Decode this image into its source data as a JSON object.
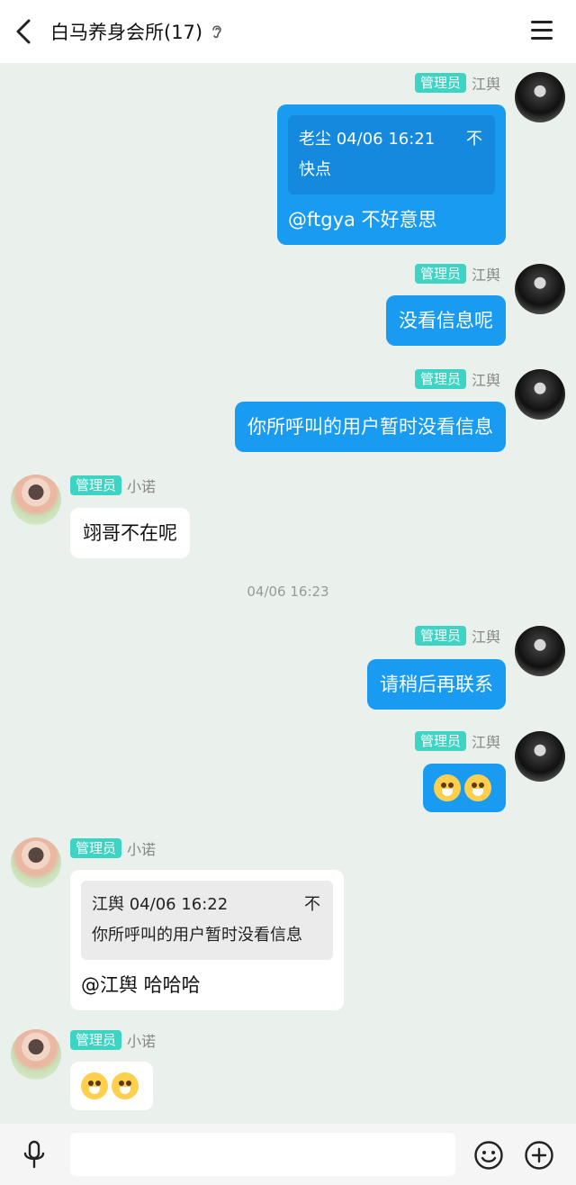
{
  "header": {
    "title": "白马养身会所(17)"
  },
  "badge_label": "管理员",
  "messages": [
    {
      "sender": "江舆",
      "quote_meta": "老尘 04/06 16:21",
      "quote_pin": "不",
      "quote_text": "快点",
      "text": "@ftgya 不好意思"
    },
    {
      "sender": "江舆",
      "text": "没看信息呢"
    },
    {
      "sender": "江舆",
      "text": "你所呼叫的用户暂时没看信息"
    },
    {
      "sender": "小诺",
      "text": "翊哥不在呢"
    },
    {
      "sender": "江舆",
      "text": "请稍后再联系"
    },
    {
      "sender": "江舆",
      "emoji": "shiba-emoji x2"
    },
    {
      "sender": "小诺",
      "quote_meta": "江舆 04/06 16:22",
      "quote_pin": "不",
      "quote_text": "你所呼叫的用户暂时没看信息",
      "text": "@江舆 哈哈哈"
    },
    {
      "sender": "小诺",
      "emoji": "shiba-emoji x2"
    }
  ],
  "timestamp": "04/06 16:23",
  "colors": {
    "accent": "#1a9bf2",
    "badge": "#3dd4c4",
    "background": "#eaf0eb"
  }
}
